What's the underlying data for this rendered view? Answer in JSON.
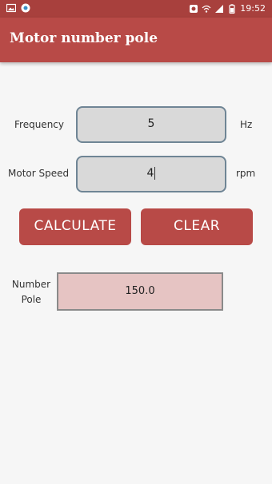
{
  "status_bar": {
    "time": "19:52",
    "left_icons": [
      "gallery-icon",
      "chat-icon"
    ],
    "right_icons": [
      "alarm-icon",
      "wifi-icon",
      "signal-icon",
      "battery-icon"
    ]
  },
  "app_bar": {
    "title": "Motor number pole"
  },
  "form": {
    "frequency": {
      "label": "Frequency",
      "value": "5",
      "unit": "Hz"
    },
    "motor_speed": {
      "label": "Motor Speed",
      "value": "4",
      "unit": "rpm"
    }
  },
  "buttons": {
    "calculate_label": "CALCULATE",
    "clear_label": "CLEAR"
  },
  "result": {
    "label_line1": "Number",
    "label_line2": "Pole",
    "value": "150.0"
  },
  "colors": {
    "status_bar": "#a8403d",
    "app_bar": "#b84a47",
    "button": "#b84a47",
    "result_box": "#e6c4c3",
    "field_bg": "#d9d9d9",
    "field_border": "#6f8595"
  }
}
